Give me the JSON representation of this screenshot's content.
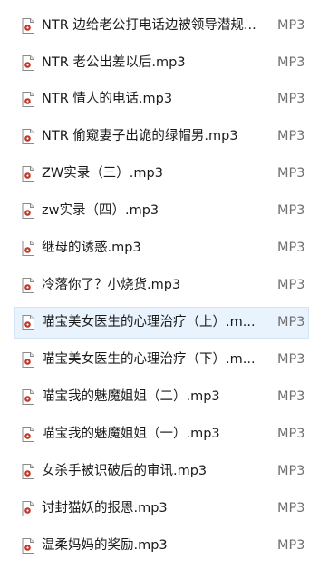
{
  "files": [
    {
      "name": "NTR 边给老公打电话边被领导潜规...",
      "type": "MP3"
    },
    {
      "name": "NTR 老公出差以后.mp3",
      "type": "MP3"
    },
    {
      "name": "NTR 情人的电话.mp3",
      "type": "MP3"
    },
    {
      "name": "NTR 偷窥妻子出诡的绿帽男.mp3",
      "type": "MP3"
    },
    {
      "name": "ZW实录（三）.mp3",
      "type": "MP3"
    },
    {
      "name": "zw实录（四）.mp3",
      "type": "MP3"
    },
    {
      "name": "继母的诱惑.mp3",
      "type": "MP3"
    },
    {
      "name": "冷落你了？小烧货.mp3",
      "type": "MP3"
    },
    {
      "name": "喵宝美女医生的心理治疗（上）.m...",
      "type": "MP3",
      "selected": true
    },
    {
      "name": "喵宝美女医生的心理治疗（下）.m...",
      "type": "MP3"
    },
    {
      "name": "喵宝我的魅魔姐姐（二）.mp3",
      "type": "MP3"
    },
    {
      "name": "喵宝我的魅魔姐姐（一）.mp3",
      "type": "MP3"
    },
    {
      "name": "女杀手被识破后的审讯.mp3",
      "type": "MP3"
    },
    {
      "name": "讨封猫妖的报恩.mp3",
      "type": "MP3"
    },
    {
      "name": "温柔妈妈的奖励.mp3",
      "type": "MP3"
    }
  ],
  "icon": "mp3-audio-file-icon",
  "colors": {
    "selected_background": "#e9f3fd",
    "selected_border": "#d3e6f8",
    "icon_accent": "#c0392b"
  }
}
